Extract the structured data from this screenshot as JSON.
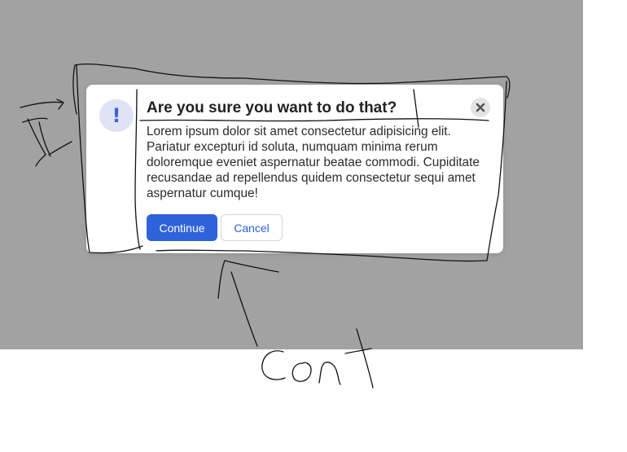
{
  "dialog": {
    "icon": "exclamation-icon",
    "icon_glyph": "!",
    "title": "Are you sure you want to do that?",
    "close_icon": "close-icon",
    "message": "Lorem ipsum dolor sit amet consectetur adipisicing elit. Pariatur excepturi id soluta, numquam minima rerum doloremque eveniet aspernatur beatae commodi. Cupiditate recusandae ad repellendus quidem consectetur sequi amet aspernatur cumque!",
    "continue_label": "Continue",
    "cancel_label": "Cancel"
  },
  "colors": {
    "overlay": "#a2a2a2",
    "accent": "#2e63dc",
    "icon_badge": "#e0e2f6"
  },
  "annotation": {
    "handwritten_text": "Cont"
  }
}
